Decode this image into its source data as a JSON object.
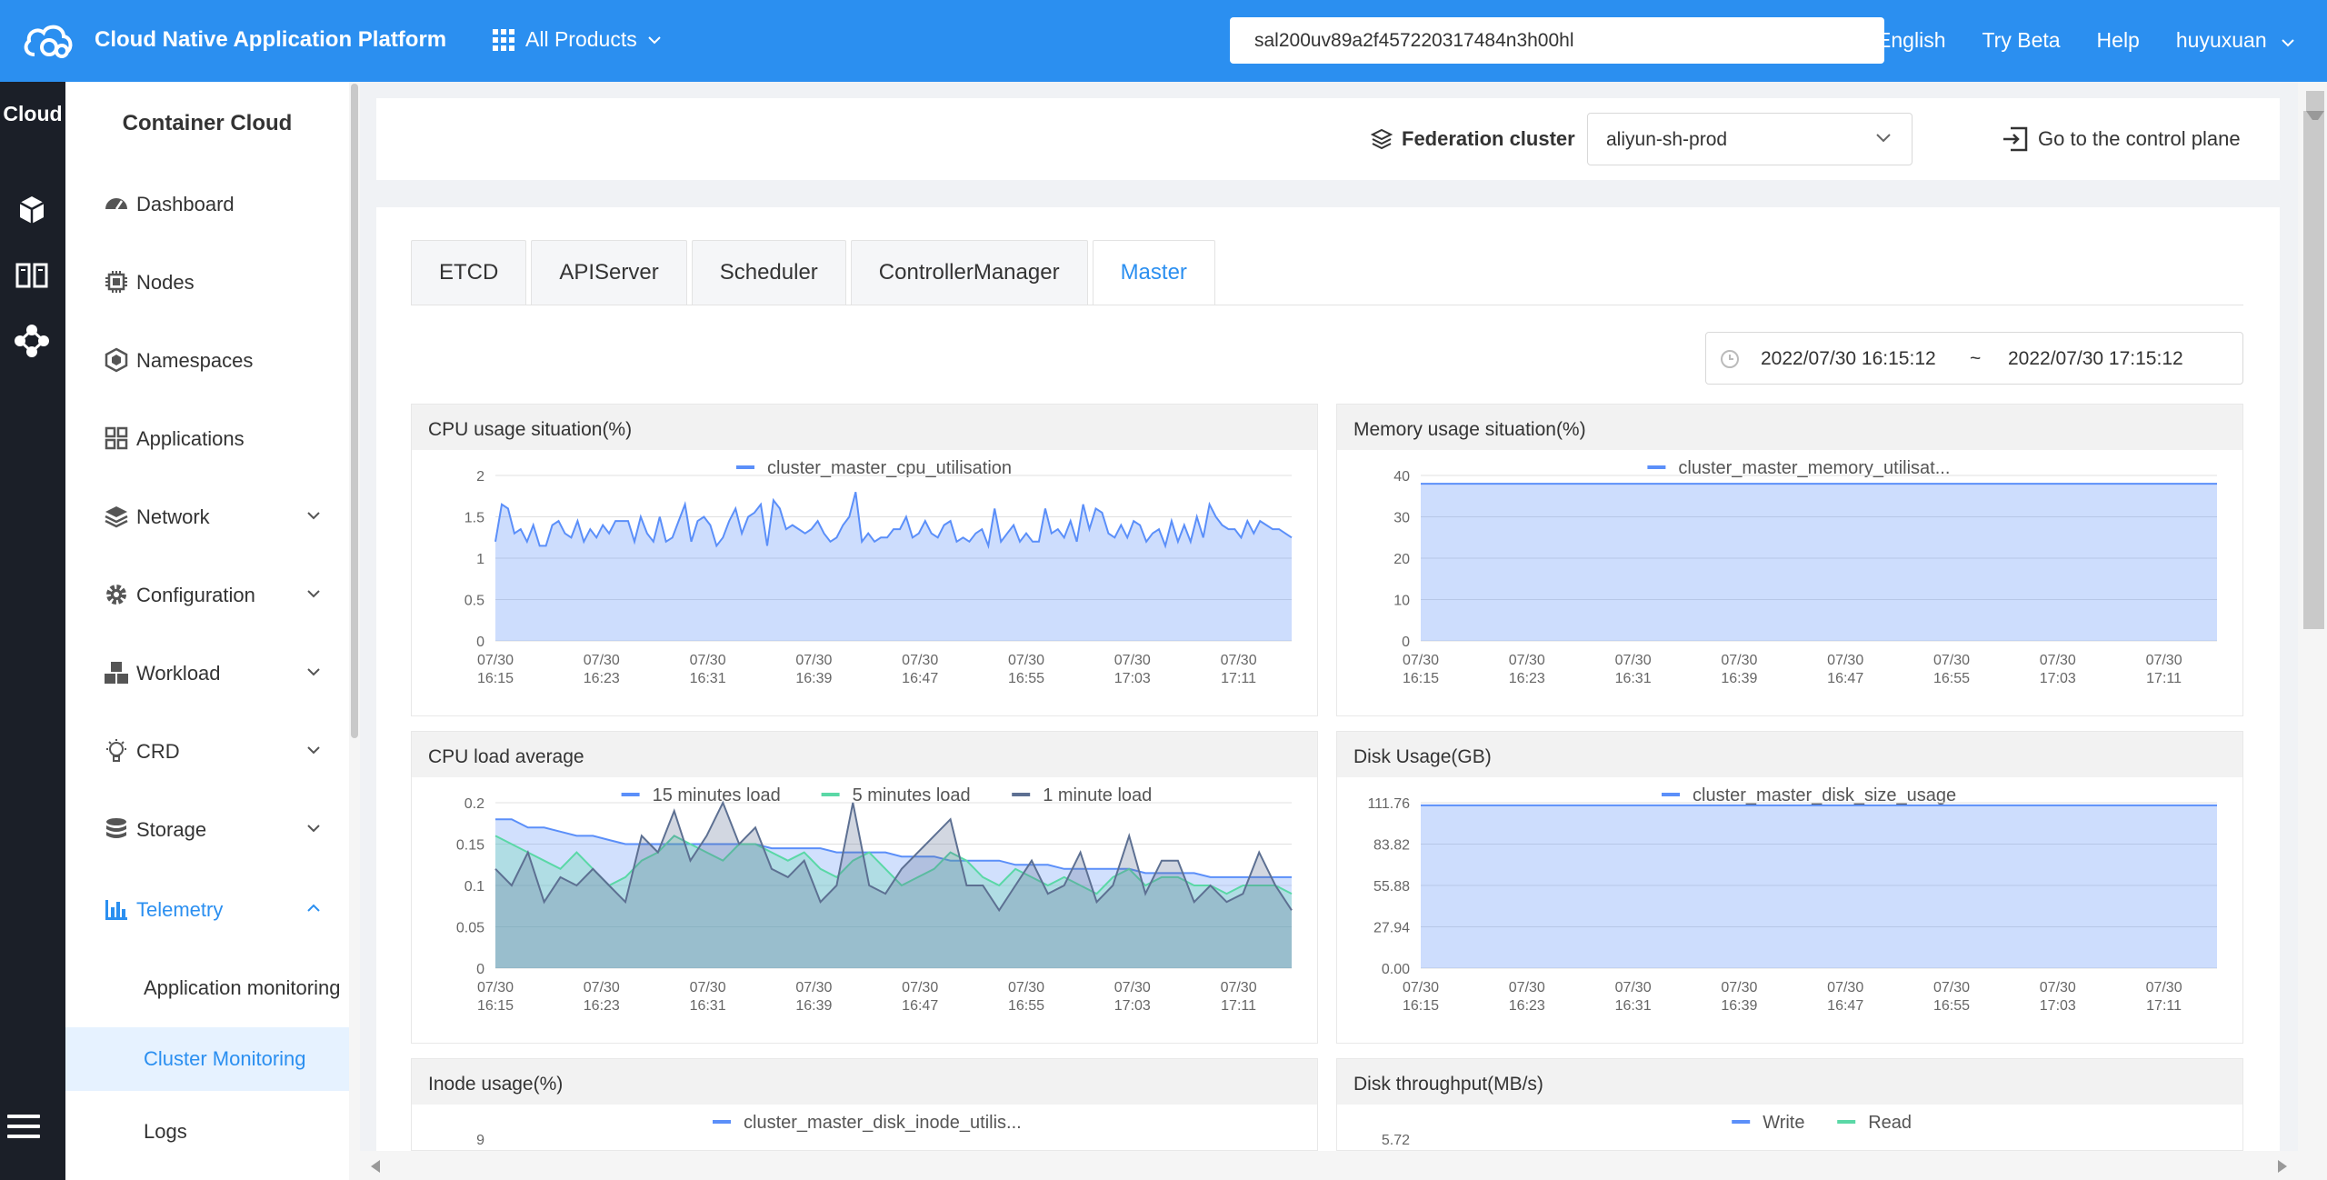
{
  "topbar": {
    "brand": "Cloud Native Application Platform",
    "products_label": "All Products",
    "search_value": "sal200uv89a2f457220317484n3h00hl",
    "links": [
      "English",
      "Try Beta",
      "Help",
      "huyuxuan"
    ],
    "color": "#2b8ff0"
  },
  "rail": {
    "title": "Cloud"
  },
  "sidebar": {
    "title": "Container Cloud",
    "items": [
      {
        "label": "Dashboard",
        "icon": "dashboard-icon",
        "expandable": false
      },
      {
        "label": "Nodes",
        "icon": "chip-icon",
        "expandable": false
      },
      {
        "label": "Namespaces",
        "icon": "namespace-icon",
        "expandable": false
      },
      {
        "label": "Applications",
        "icon": "apps-grid-icon",
        "expandable": false
      },
      {
        "label": "Network",
        "icon": "layers-icon",
        "expandable": true
      },
      {
        "label": "Configuration",
        "icon": "gear-icon",
        "expandable": true
      },
      {
        "label": "Workload",
        "icon": "cubes-icon",
        "expandable": true
      },
      {
        "label": "CRD",
        "icon": "bulb-icon",
        "expandable": true
      },
      {
        "label": "Storage",
        "icon": "database-icon",
        "expandable": true
      },
      {
        "label": "Telemetry",
        "icon": "bar-chart-icon",
        "expandable": true,
        "active": true
      }
    ],
    "sub_items": [
      "Application monitoring",
      "Cluster Monitoring",
      "Logs"
    ],
    "selected_sub": "Cluster Monitoring"
  },
  "header": {
    "federation_label": "Federation cluster",
    "federation_value": "aliyun-sh-prod",
    "goto_label": "Go to the control plane"
  },
  "tabs": [
    "ETCD",
    "APIServer",
    "Scheduler",
    "ControllerManager",
    "Master"
  ],
  "active_tab": "Master",
  "date_range": {
    "start": "2022/07/30 16:15:12",
    "separator": "~",
    "end": "2022/07/30 17:15:12"
  },
  "x_ticks": [
    "07/30|16:15",
    "07/30|16:23",
    "07/30|16:31",
    "07/30|16:39",
    "07/30|16:47",
    "07/30|16:55",
    "07/30|17:03",
    "07/30|17:11"
  ],
  "panels": [
    {
      "title": "CPU usage situation(%)"
    },
    {
      "title": "Memory usage situation(%)"
    },
    {
      "title": "CPU load average"
    },
    {
      "title": "Disk Usage(GB)"
    },
    {
      "title": "Inode usage(%)"
    },
    {
      "title": "Disk throughput(MB/s)"
    }
  ],
  "chart_data": [
    {
      "type": "area",
      "title": "CPU usage situation(%)",
      "ylim": [
        0,
        2
      ],
      "yticks": [
        "2",
        "1.5",
        "1",
        "0.5",
        "0"
      ],
      "series": [
        {
          "name": "cluster_master_cpu_utilisation",
          "color": "#5b8ff9",
          "values": [
            1.2,
            1.65,
            1.6,
            1.3,
            1.35,
            1.2,
            1.4,
            1.15,
            1.15,
            1.4,
            1.45,
            1.3,
            1.25,
            1.45,
            1.2,
            1.35,
            1.25,
            1.4,
            1.3,
            1.45,
            1.45,
            1.45,
            1.2,
            1.5,
            1.3,
            1.2,
            1.5,
            1.2,
            1.25,
            1.45,
            1.65,
            1.2,
            1.45,
            1.5,
            1.4,
            1.15,
            1.25,
            1.45,
            1.6,
            1.3,
            1.5,
            1.55,
            1.65,
            1.15,
            1.7,
            1.6,
            1.35,
            1.4,
            1.35,
            1.3,
            1.35,
            1.45,
            1.3,
            1.2,
            1.25,
            1.4,
            1.5,
            1.8,
            1.2,
            1.3,
            1.2,
            1.25,
            1.25,
            1.35,
            1.35,
            1.5,
            1.25,
            1.3,
            1.45,
            1.3,
            1.25,
            1.4,
            1.45,
            1.2,
            1.25,
            1.2,
            1.3,
            1.35,
            1.15,
            1.6,
            1.2,
            1.3,
            1.4,
            1.2,
            1.3,
            1.2,
            1.2,
            1.6,
            1.3,
            1.35,
            1.25,
            1.45,
            1.2,
            1.65,
            1.35,
            1.6,
            1.55,
            1.3,
            1.25,
            1.4,
            1.25,
            1.45,
            1.4,
            1.2,
            1.3,
            1.35,
            1.15,
            1.45,
            1.2,
            1.4,
            1.2,
            1.5,
            1.25,
            1.65,
            1.5,
            1.4,
            1.35,
            1.35,
            1.25,
            1.45,
            1.3,
            1.45,
            1.4,
            1.35,
            1.35,
            1.3,
            1.25
          ]
        }
      ]
    },
    {
      "type": "area",
      "title": "Memory usage situation(%)",
      "ylim": [
        0,
        40
      ],
      "yticks": [
        "40",
        "30",
        "20",
        "10",
        "0"
      ],
      "series": [
        {
          "name": "cluster_master_memory_utilisat...",
          "color": "#5b8ff9",
          "values": [
            38,
            38,
            38,
            38,
            38,
            38,
            38,
            38,
            38,
            38,
            38,
            38,
            38,
            38,
            38,
            38,
            38,
            38,
            38,
            38,
            38,
            38,
            38,
            38,
            38,
            38,
            38,
            38,
            38,
            38,
            38,
            38,
            38,
            38,
            38,
            38,
            38,
            38,
            38,
            38
          ]
        }
      ]
    },
    {
      "type": "area",
      "title": "CPU load average",
      "ylim": [
        0,
        0.2
      ],
      "yticks": [
        "0.2",
        "0.15",
        "0.1",
        "0.05",
        "0"
      ],
      "series": [
        {
          "name": "15 minutes load",
          "color": "#5b8ff9",
          "values": [
            0.18,
            0.18,
            0.17,
            0.17,
            0.165,
            0.16,
            0.16,
            0.155,
            0.15,
            0.15,
            0.15,
            0.15,
            0.15,
            0.15,
            0.15,
            0.15,
            0.15,
            0.145,
            0.145,
            0.145,
            0.145,
            0.14,
            0.14,
            0.14,
            0.14,
            0.135,
            0.135,
            0.135,
            0.13,
            0.13,
            0.13,
            0.13,
            0.125,
            0.125,
            0.125,
            0.12,
            0.12,
            0.12,
            0.12,
            0.12,
            0.115,
            0.115,
            0.115,
            0.115,
            0.11,
            0.11,
            0.11,
            0.11,
            0.11,
            0.11
          ]
        },
        {
          "name": "5 minutes load",
          "color": "#5ad8a6",
          "values": [
            0.16,
            0.15,
            0.14,
            0.13,
            0.12,
            0.14,
            0.12,
            0.1,
            0.11,
            0.13,
            0.14,
            0.16,
            0.15,
            0.14,
            0.13,
            0.15,
            0.15,
            0.14,
            0.13,
            0.14,
            0.12,
            0.11,
            0.13,
            0.14,
            0.12,
            0.1,
            0.11,
            0.12,
            0.14,
            0.13,
            0.11,
            0.1,
            0.12,
            0.11,
            0.1,
            0.11,
            0.1,
            0.09,
            0.11,
            0.12,
            0.1,
            0.11,
            0.11,
            0.1,
            0.1,
            0.09,
            0.1,
            0.1,
            0.1,
            0.09
          ]
        },
        {
          "name": "1 minute load",
          "color": "#5d7092",
          "values": [
            0.12,
            0.1,
            0.14,
            0.08,
            0.11,
            0.1,
            0.12,
            0.1,
            0.08,
            0.16,
            0.14,
            0.19,
            0.13,
            0.16,
            0.2,
            0.15,
            0.17,
            0.12,
            0.11,
            0.13,
            0.08,
            0.1,
            0.2,
            0.1,
            0.09,
            0.12,
            0.14,
            0.16,
            0.18,
            0.1,
            0.1,
            0.07,
            0.1,
            0.13,
            0.09,
            0.1,
            0.14,
            0.08,
            0.1,
            0.16,
            0.09,
            0.13,
            0.13,
            0.08,
            0.1,
            0.08,
            0.09,
            0.14,
            0.1,
            0.07
          ]
        }
      ]
    },
    {
      "type": "area",
      "title": "Disk Usage(GB)",
      "ylim": [
        0,
        111.76
      ],
      "yticks": [
        "111.76",
        "83.82",
        "55.88",
        "27.94",
        "0.00"
      ],
      "series": [
        {
          "name": "cluster_master_disk_size_usage",
          "color": "#5b8ff9",
          "values": [
            110,
            110,
            110,
            110,
            110,
            110,
            110,
            110,
            110,
            110,
            110,
            110,
            110,
            110,
            110,
            110,
            110,
            110,
            110,
            110
          ]
        }
      ]
    },
    {
      "type": "area",
      "title": "Inode usage(%)",
      "yticks": [
        "9"
      ],
      "series": [
        {
          "name": "cluster_master_disk_inode_utilis...",
          "color": "#5b8ff9",
          "values": []
        }
      ]
    },
    {
      "type": "area",
      "title": "Disk throughput(MB/s)",
      "yticks": [
        "5.72"
      ],
      "series": [
        {
          "name": "Write",
          "color": "#5b8ff9",
          "values": []
        },
        {
          "name": "Read",
          "color": "#5ad8a6",
          "values": []
        }
      ]
    }
  ]
}
